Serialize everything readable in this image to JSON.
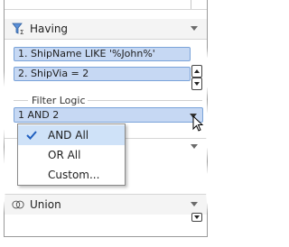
{
  "having": {
    "title": "Having",
    "icon": "funnel-sigma-icon",
    "conditions": [
      "1. ShipName LIKE '%John%'",
      "2. ShipVia = 2"
    ]
  },
  "filter_logic": {
    "label": "Filter Logic",
    "value": "1 AND 2",
    "options": [
      {
        "label": "AND All",
        "checked": true
      },
      {
        "label": "OR All",
        "checked": false
      },
      {
        "label": "Custom...",
        "checked": false
      }
    ]
  },
  "union": {
    "title": "Union",
    "icon": "union-circles-icon"
  },
  "colors": {
    "selection": "#c6d8f3",
    "selection_border": "#7aa3d9",
    "menu_highlight": "#cfe2f8",
    "check": "#1f5fbf"
  }
}
